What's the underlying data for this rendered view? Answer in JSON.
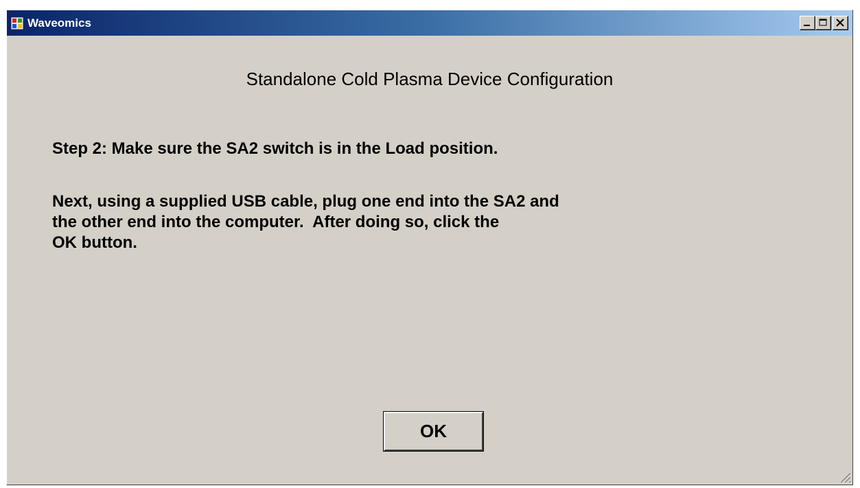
{
  "window": {
    "title": "Waveomics",
    "icon": "app-window-icon",
    "controls": {
      "minimize_icon": "minimize-icon",
      "maximize_icon": "maximize-icon",
      "close_icon": "close-icon"
    }
  },
  "content": {
    "heading": "Standalone Cold Plasma Device Configuration",
    "step": "Step 2: Make sure the SA2 switch is in the Load position.",
    "instructions": [
      "Next, using a supplied USB cable, plug one end into the SA2 and",
      "the other end into the computer.  After doing so, click the",
      "OK button."
    ]
  },
  "buttons": {
    "ok_label": "OK"
  },
  "colors": {
    "window_background": "#d4d0c8",
    "titlebar_start": "#0a246a",
    "titlebar_end": "#a6caf0",
    "title_text": "#ffffff"
  }
}
